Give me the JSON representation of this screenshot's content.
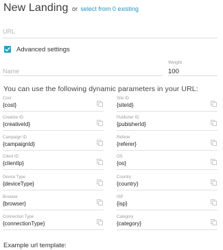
{
  "header": {
    "title": "New Landing",
    "or_text": "or",
    "select_link": "select from 0 existing"
  },
  "url_field": {
    "placeholder": "URL",
    "value": ""
  },
  "advanced": {
    "label": "Advanced settings",
    "checked": true
  },
  "name_field": {
    "placeholder": "Name"
  },
  "weight_field": {
    "label": "Weight",
    "value": "100"
  },
  "params_section": {
    "title": "You can use the following dynamic parameters in your URL:",
    "left": [
      {
        "label": "Cost",
        "value": "{cost}"
      },
      {
        "label": "Creative ID",
        "value": "{creativeId}"
      },
      {
        "label": "Campaign ID",
        "value": "{campaignId}"
      },
      {
        "label": "Client ID",
        "value": "{clientIp}"
      },
      {
        "label": "Device Type",
        "value": "{deviceType}"
      },
      {
        "label": "Browser",
        "value": "{browser}"
      },
      {
        "label": "Connection Type",
        "value": "{connectionType}"
      }
    ],
    "right": [
      {
        "label": "Site ID",
        "value": "{siteId}"
      },
      {
        "label": "Publisher ID",
        "value": "{pubisherId}"
      },
      {
        "label": "Referer",
        "value": "{referer}"
      },
      {
        "label": "OS",
        "value": "{os}"
      },
      {
        "label": "Country",
        "value": "{country}"
      },
      {
        "label": "ISP",
        "value": "{isp}"
      },
      {
        "label": "Category",
        "value": "{category}"
      }
    ]
  },
  "example": {
    "title": "Example url template:"
  },
  "colors": {
    "accent": "#26a0c9",
    "link": "#2596be",
    "divider": "#dcdcdc"
  },
  "icons": {
    "copy": "copy-icon",
    "check": "check-icon"
  }
}
